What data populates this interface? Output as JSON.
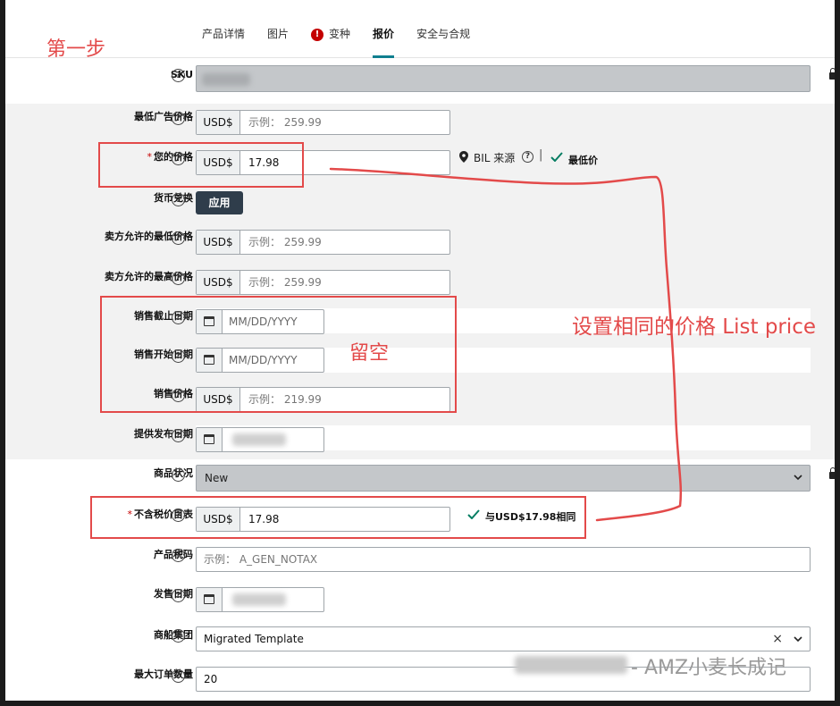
{
  "tabs": [
    {
      "label": "产品详情"
    },
    {
      "label": "图片"
    },
    {
      "label": "变种",
      "warning_icon": "!"
    },
    {
      "label": "报价",
      "active": true
    },
    {
      "label": "安全与合规"
    }
  ],
  "fields": {
    "sku": {
      "label": "SKU"
    },
    "min_ad_price": {
      "label": "最低广告价格",
      "currency": "USD$",
      "placeholder": "示例： 259.99"
    },
    "your_price": {
      "label": "您的价格",
      "required": "*",
      "currency": "USD$",
      "value": "17.98"
    },
    "bil": {
      "source": "BIL 来源",
      "separator": "|",
      "lowest_label": "最低价"
    },
    "fx": {
      "label": "货币兑换",
      "button": "应用"
    },
    "seller_min": {
      "label": "卖方允许的最低价格",
      "currency": "USD$",
      "placeholder": "示例： 259.99"
    },
    "seller_max": {
      "label": "卖方允许的最高价格",
      "currency": "USD$",
      "placeholder": "示例： 259.99"
    },
    "sale_end": {
      "label": "销售截止日期",
      "placeholder": "MM/DD/YYYY"
    },
    "sale_start": {
      "label": "销售开始日期",
      "placeholder": "MM/DD/YYYY"
    },
    "sale_price": {
      "label": "销售价格",
      "currency": "USD$",
      "placeholder": "示例： 219.99"
    },
    "release_date": {
      "label": "提供发布日期"
    },
    "condition": {
      "label": "商品状况",
      "value": "New"
    },
    "list_price": {
      "label": "不含税价目表",
      "required": "*",
      "currency": "USD$",
      "value": "17.98",
      "match_text": "与USD$17.98相同"
    },
    "tax_code": {
      "label": "产品税码",
      "placeholder": "示例： A_GEN_NOTAX"
    },
    "sale_date": {
      "label": "发售日期"
    },
    "shipping_group": {
      "label": "商船集团",
      "value": "Migrated Template",
      "clear": "×"
    },
    "max_qty": {
      "label": "最大订单数量",
      "value": "20"
    }
  },
  "annotations": {
    "step1": "第一步",
    "leave_blank": "留空",
    "same_price": "设置相同的价格 List price"
  },
  "watermark": "AMZ小麦长成记",
  "colors": {
    "accent": "#0f7f8f",
    "annotation_red": "#e34a4a",
    "required_red": "#c40000",
    "button_dark": "#2f3d4b",
    "check_green": "#067d62"
  }
}
